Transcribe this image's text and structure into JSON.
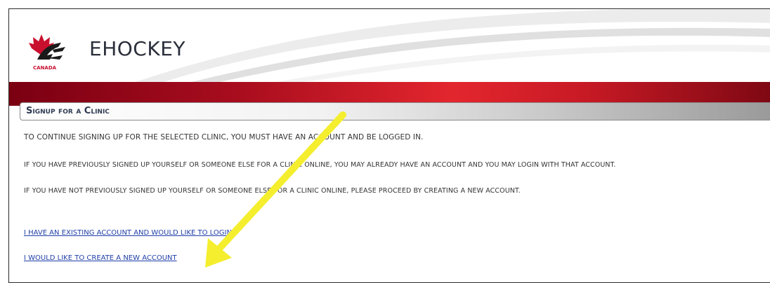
{
  "header": {
    "brand": "EHOCKEY",
    "logo_text": "CANADA",
    "colors": {
      "brand_red": "#c8102e",
      "bar_dark": "#7a0012",
      "bar_light": "#e3262e"
    }
  },
  "section": {
    "title": "Signup for a Clinic"
  },
  "content": {
    "paragraph_1": "To continue signing up for the selected clinic, you must have an account and be logged in.",
    "paragraph_2": "If you have previously signed up yourself or someone else for a clinic online, you may already have an account and you may login with that account.",
    "paragraph_3": "If you have NOT previously signed up yourself or someone else for a clinic online, please proceed by creating a new account."
  },
  "links": {
    "existing_account": "I have an existing account and would like to login",
    "create_account": "I would like to create a new account",
    "link_color": "#1f3ea8"
  },
  "annotation": {
    "arrow_color": "#f4ee2e",
    "arrow_target": "create_account"
  }
}
